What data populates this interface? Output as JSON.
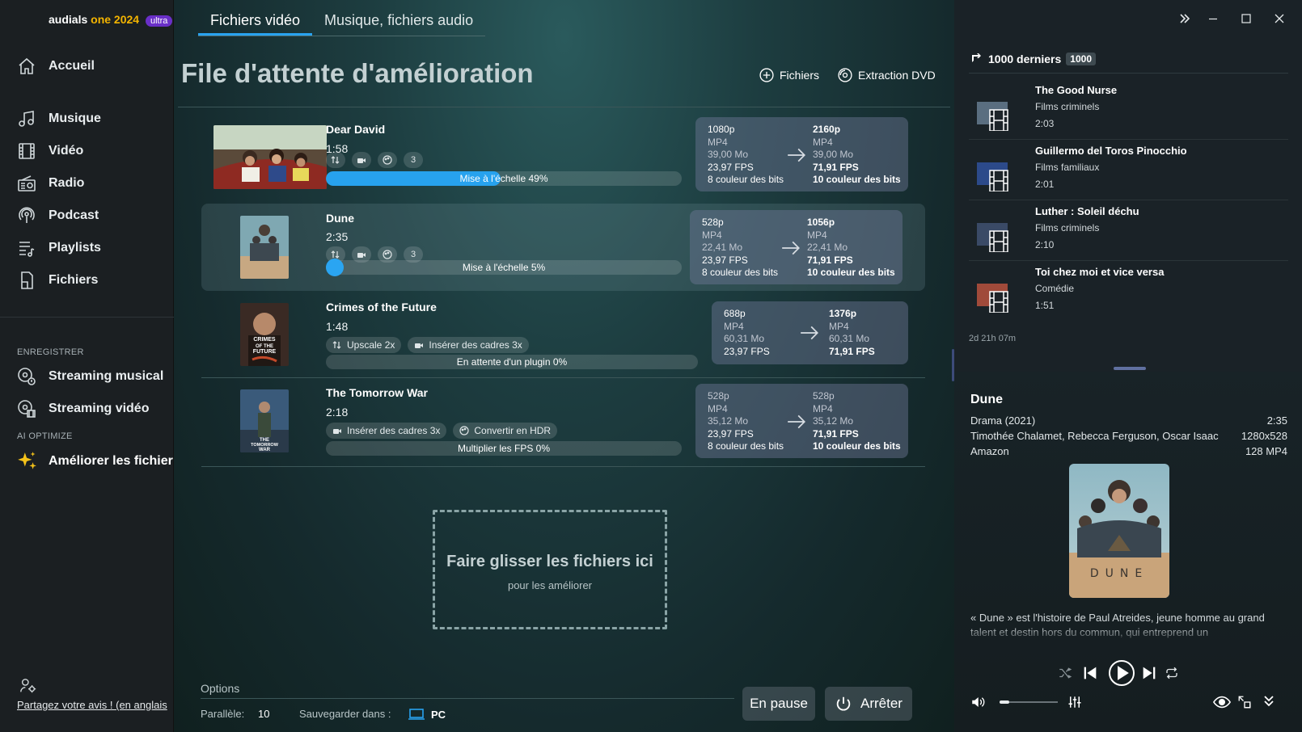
{
  "brand": {
    "name": "audials",
    "one": "one 2024",
    "badge": "ultra"
  },
  "sidebar": {
    "items": [
      {
        "label": "Accueil",
        "icon": "home-icon"
      },
      {
        "label": "Musique",
        "icon": "music-icon"
      },
      {
        "label": "Vidéo",
        "icon": "film-icon"
      },
      {
        "label": "Radio",
        "icon": "radio-icon"
      },
      {
        "label": "Podcast",
        "icon": "podcast-icon"
      },
      {
        "label": "Playlists",
        "icon": "playlist-icon"
      },
      {
        "label": "Fichiers",
        "icon": "file-icon"
      }
    ],
    "section_record": "ENREGISTRER",
    "record_items": [
      {
        "label": "Streaming musical",
        "icon": "music-stream-icon"
      },
      {
        "label": "Streaming vidéo",
        "icon": "video-stream-icon"
      }
    ],
    "section_ai": "AI OPTIMIZE",
    "ai_item": {
      "label": "Améliorer les fichier",
      "icon": "sparkle-icon"
    },
    "feedback": "Partagez votre avis ! (en anglais"
  },
  "main": {
    "tabs": [
      "Fichiers vidéo",
      "Musique, fichiers audio"
    ],
    "title": "File d'attente d'amélioration",
    "actions": {
      "files": "Fichiers",
      "dvd": "Extraction DVD"
    },
    "rows": [
      {
        "title": "Dear David",
        "duration": "1:58",
        "count": "3",
        "progress_label": "Mise à l'échelle 49%",
        "progress": 0.49,
        "src": [
          "1080p",
          "MP4",
          "39,00 Mo",
          "23,97 FPS",
          "8 couleur des bits"
        ],
        "dst": [
          "2160p",
          "MP4",
          "39,00 Mo",
          "71,91 FPS",
          "10 couleur des bits"
        ]
      },
      {
        "title": "Dune",
        "duration": "2:35",
        "count": "3",
        "progress_label": "Mise à l'échelle 5%",
        "progress": 0.05,
        "src": [
          "528p",
          "MP4",
          "22,41 Mo",
          "23,97 FPS",
          "8 couleur des bits"
        ],
        "dst": [
          "1056p",
          "MP4",
          "22,41 Mo",
          "71,91 FPS",
          "10 couleur des bits"
        ]
      },
      {
        "title": "Crimes of the Future",
        "duration": "1:48",
        "chips": [
          "Upscale 2x",
          "Insérer des cadres 3x"
        ],
        "progress_label": "En attente d'un plugin 0%",
        "progress": 0,
        "poster_text": "CRIMES OF THE FUTURE",
        "src": [
          "688p",
          "MP4",
          "60,31 Mo",
          "23,97 FPS"
        ],
        "dst": [
          "1376p",
          "MP4",
          "60,31 Mo",
          "71,91 FPS"
        ]
      },
      {
        "title": "The Tomorrow War",
        "duration": "2:18",
        "chips": [
          "Insérer des cadres 3x",
          "Convertir en HDR"
        ],
        "progress_label": "Multiplier les FPS 0%",
        "progress": 0,
        "poster_text": "THE TOMORROW WAR",
        "src": [
          "528p",
          "MP4",
          "35,12 Mo",
          "23,97 FPS",
          "8 couleur des bits"
        ],
        "dst": [
          "528p",
          "MP4",
          "35,12 Mo",
          "71,91 FPS",
          "10 couleur des bits"
        ]
      }
    ],
    "dropzone": {
      "title": "Faire glisser les fichiers ici",
      "subtitle": "pour les améliorer"
    },
    "options": {
      "label": "Options",
      "parallel_label": "Parallèle:",
      "parallel_value": "10",
      "save_label": "Sauvegarder dans :",
      "save_value": "PC"
    },
    "buttons": {
      "pause": "En pause",
      "stop": "Arrêter"
    }
  },
  "right": {
    "recent_title": "1000 derniers",
    "recent_count": "1000",
    "recent": [
      {
        "title": "The Good Nurse",
        "genre": "Films criminels",
        "duration": "2:03"
      },
      {
        "title": "Guillermo del Toros Pinocchio",
        "genre": "Films familiaux",
        "duration": "2:01"
      },
      {
        "title": "Luther : Soleil déchu",
        "genre": "Films criminels",
        "duration": "2:10"
      },
      {
        "title": "Toi chez moi et vice versa",
        "genre": "Comédie",
        "duration": "1:51"
      }
    ],
    "total_time": "2d 21h 07m",
    "detail": {
      "title": "Dune",
      "genre": "Drama (2021)",
      "duration": "2:35",
      "cast": "Timothée Chalamet, Rebecca Ferguson, Oscar Isaac",
      "resolution": "1280x528",
      "source": "Amazon",
      "format": "128 MP4",
      "poster_text": "DUNE",
      "description": "« Dune » est l'histoire de Paul Atreides, jeune homme au grand talent et destin hors du commun, qui entreprend un"
    }
  },
  "colors": {
    "accent": "#29a3f0",
    "brand_badge": "#6a2fc8"
  }
}
